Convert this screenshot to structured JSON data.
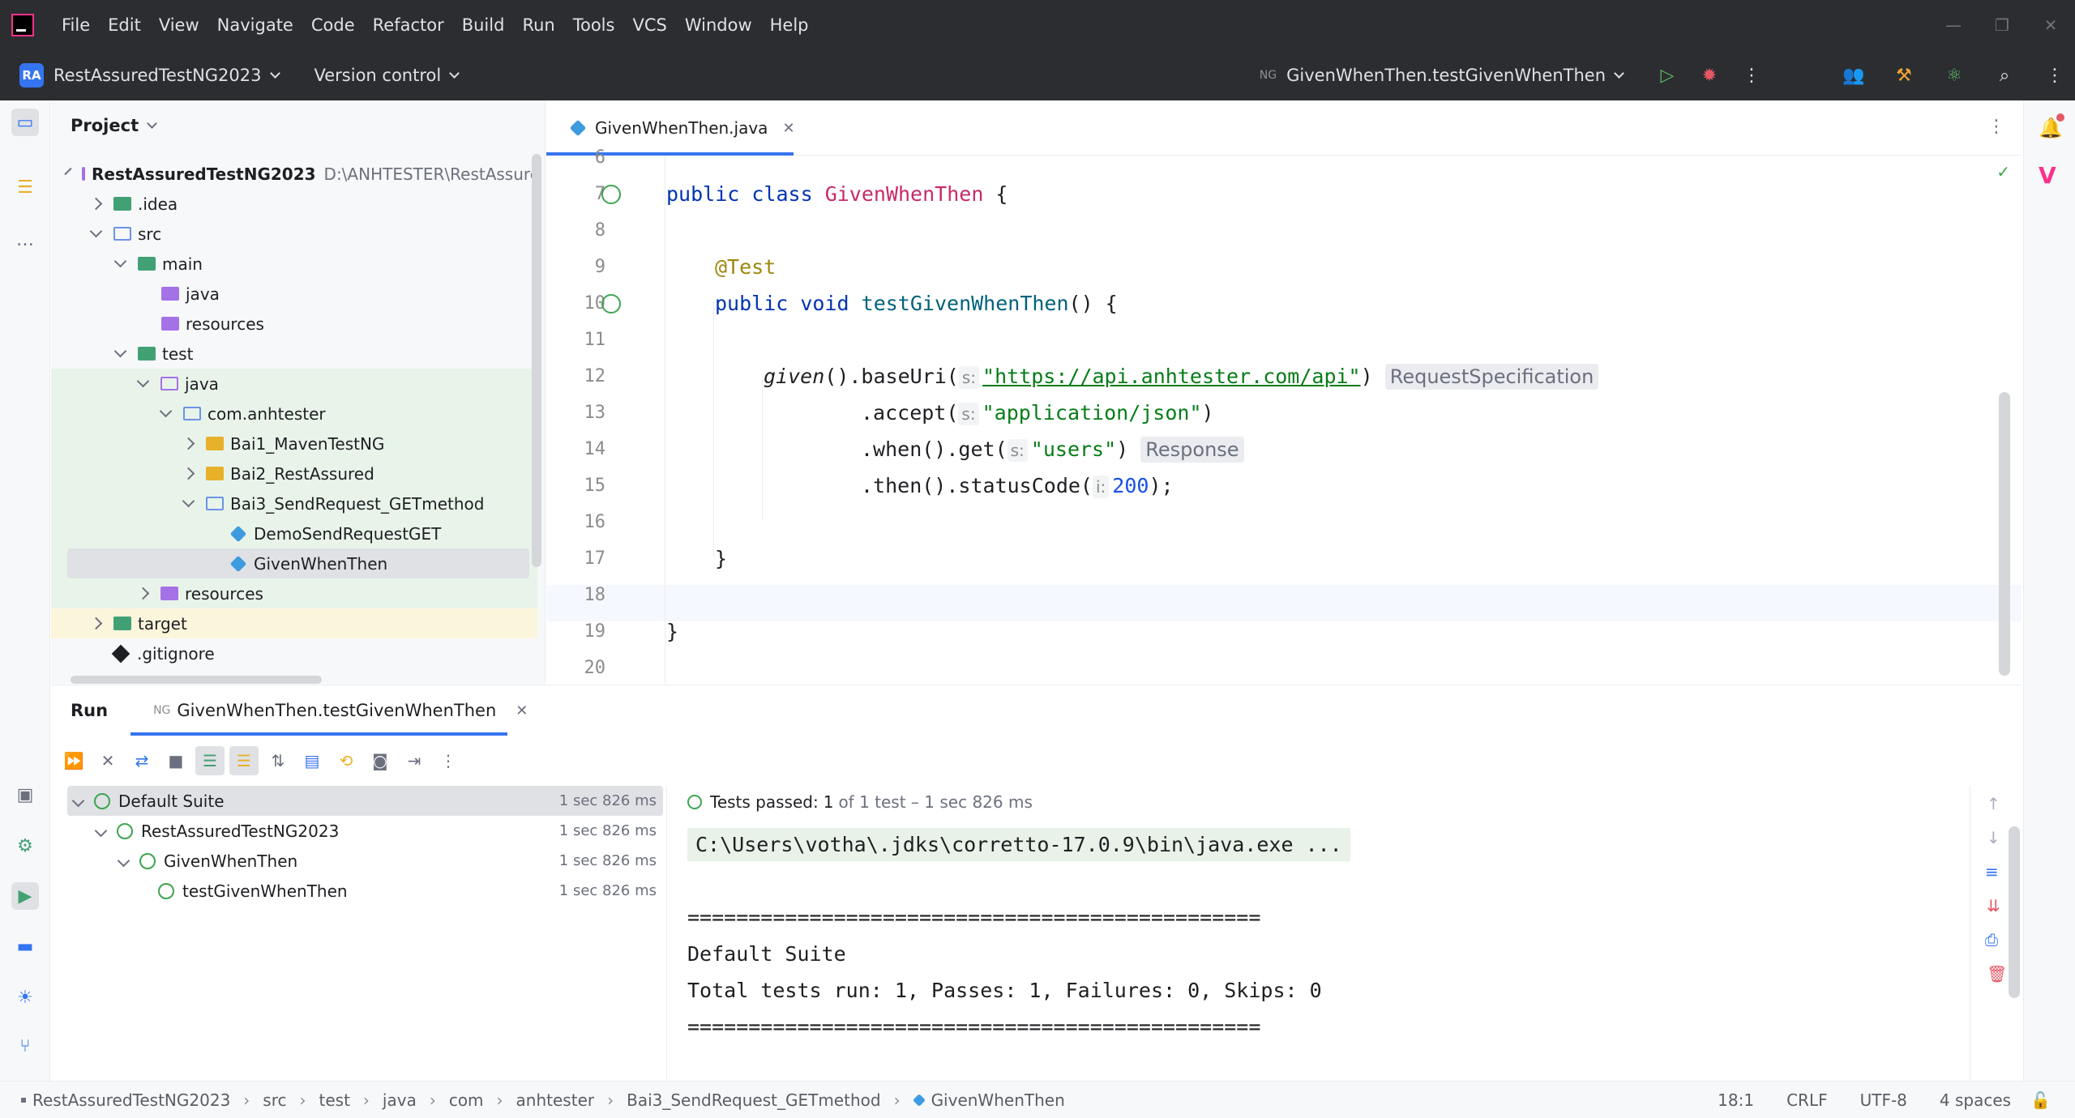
{
  "menu": [
    "File",
    "Edit",
    "View",
    "Navigate",
    "Code",
    "Refactor",
    "Build",
    "Run",
    "Tools",
    "VCS",
    "Window",
    "Help"
  ],
  "toolbar": {
    "project_badge": "RA",
    "project_name": "RestAssuredTestNG2023",
    "vcs_label": "Version control",
    "run_config": "GivenWhenThen.testGivenWhenThen"
  },
  "project_panel": {
    "title": "Project",
    "root_name": "RestAssuredTestNG2023",
    "root_path": "D:\\ANHTESTER\\RestAssure",
    "items": [
      {
        "label": ".idea"
      },
      {
        "label": "src"
      },
      {
        "label": "main"
      },
      {
        "label": "java"
      },
      {
        "label": "resources"
      },
      {
        "label": "test"
      },
      {
        "label": "java"
      },
      {
        "label": "com.anhtester"
      },
      {
        "label": "Bai1_MavenTestNG"
      },
      {
        "label": "Bai2_RestAssured"
      },
      {
        "label": "Bai3_SendRequest_GETmethod"
      },
      {
        "label": "DemoSendRequestGET"
      },
      {
        "label": "GivenWhenThen"
      },
      {
        "label": "resources"
      },
      {
        "label": "target"
      },
      {
        "label": ".gitignore"
      }
    ]
  },
  "editor": {
    "tab_label": "GivenWhenThen.java",
    "line_numbers": [
      "6",
      "7",
      "8",
      "9",
      "10",
      "11",
      "12",
      "13",
      "14",
      "15",
      "16",
      "17",
      "18",
      "19",
      "20"
    ],
    "code": {
      "l7_public": "public",
      "l7_class": "class",
      "l7_name": "GivenWhenThen",
      "l7_brace": " {",
      "l9_annot": "@Test",
      "l10_public": "public",
      "l10_void": "void",
      "l10_name": "testGivenWhenThen",
      "l10_rest": "() {",
      "l12_given": "given",
      "l12_call": "().baseUri(",
      "l12_hint": "s:",
      "l12_str": "\"https://api.anhtester.com/api\"",
      "l12_close": ")",
      "l12_type": "RequestSpecification",
      "l13_call": ".accept(",
      "l13_hint": "s:",
      "l13_str": "\"application/json\"",
      "l13_close": ")",
      "l14_call": ".when().get(",
      "l14_hint": "s:",
      "l14_str": "\"users\"",
      "l14_close": ")",
      "l14_type": "Response",
      "l15_call": ".then().statusCode(",
      "l15_hint": "i:",
      "l15_num": "200",
      "l15_close": ");",
      "l17_brace": "}",
      "l19_brace": "}"
    }
  },
  "run_panel": {
    "title": "Run",
    "tab_label": "GivenWhenThen.testGivenWhenThen",
    "tests": [
      {
        "label": "Default Suite",
        "time": "1 sec 826 ms"
      },
      {
        "label": "RestAssuredTestNG2023",
        "time": "1 sec 826 ms"
      },
      {
        "label": "GivenWhenThen",
        "time": "1 sec 826 ms"
      },
      {
        "label": "testGivenWhenThen",
        "time": "1 sec 826 ms"
      }
    ],
    "summary_prefix": "Tests passed:",
    "summary_count": "1",
    "summary_rest": "of 1 test – 1 sec 826 ms",
    "console": [
      "C:\\Users\\votha\\.jdks\\corretto-17.0.9\\bin\\java.exe ...",
      "",
      "===============================================",
      "Default Suite",
      "Total tests run: 1, Passes: 1, Failures: 0, Skips: 0",
      "==============================================="
    ]
  },
  "statusbar": {
    "crumbs": [
      "RestAssuredTestNG2023",
      "src",
      "test",
      "java",
      "com",
      "anhtester",
      "Bai3_SendRequest_GETmethod",
      "GivenWhenThen"
    ],
    "position": "18:1",
    "line_sep": "CRLF",
    "encoding": "UTF-8",
    "indent": "4 spaces"
  },
  "colors": {
    "accent": "#3574f0",
    "pass": "#3ea550",
    "dark_bar": "#2b2d30"
  }
}
